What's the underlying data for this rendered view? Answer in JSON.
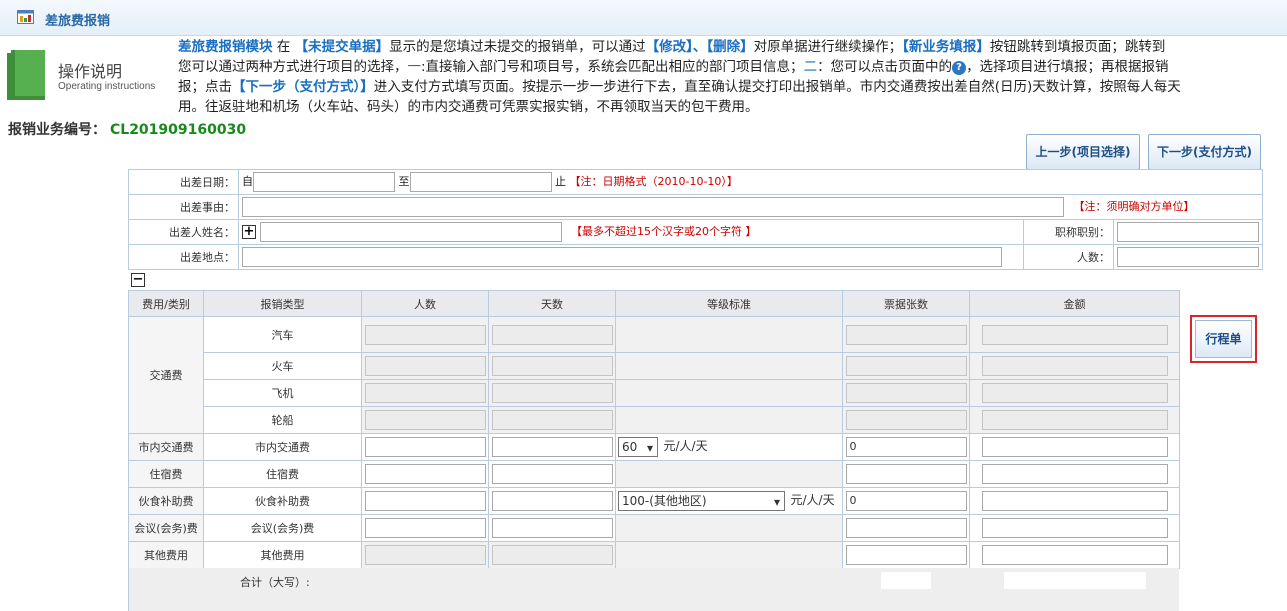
{
  "header": {
    "title": "差旅费报销",
    "icon": "report-icon"
  },
  "instructions": {
    "title": "操作说明",
    "subtitle": "Operating instructions",
    "line1": [
      {
        "t": "差旅费报销模块",
        "blue": true
      },
      {
        "t": " 在 ",
        "blue": false
      },
      {
        "t": "【未提交单据】",
        "blue": true
      },
      {
        "t": "显示的是您填过未提交的报销单，可以通过",
        "blue": false
      },
      {
        "t": "【修改】、【删除】",
        "blue": true
      },
      {
        "t": "对原单据进行继续操作；",
        "blue": false
      },
      {
        "t": "【新业务填报】",
        "blue": true
      },
      {
        "t": "按钮跳转到填报页面；跳转到",
        "blue": false
      }
    ],
    "line2a": "您可以通过两种方式进行项目的选择，",
    "line2b": "一",
    "line2c": ":直接输入部门号和项目号，系统会匹配出相应的部门项目信息；",
    "line2d": "二",
    "line2e": "：您可以点击页面中的",
    "line2f": "，选择项目进行填报；再根据报销",
    "line3a": "报；点击",
    "line3b": "【下一步（支付方式）】",
    "line3c": "进入支付方式填写页面。按提示一步一步进行下去，直至确认提交打印出报销单。市内交通费按出差自然(日历)天数计算，按照每人每天",
    "line4": "用。往返驻地和机场（火车站、码头）的市内交通费可凭票实报实销，不再领取当天的包干费用。"
  },
  "business_no": {
    "label": "报销业务编号：",
    "value": "CL201909160030"
  },
  "buttons": {
    "prev": "上一步(项目选择)",
    "next": "下一步(支付方式)",
    "itinerary": "行程单"
  },
  "form": {
    "date_label": "出差日期：",
    "from": "自",
    "to": "至",
    "end": "止",
    "date_note": "【注：日期格式（2010-10-10）】",
    "reason_label": "出差事由：",
    "reason_note": "【注：须明确对方单位】",
    "name_label": "出差人姓名：",
    "name_note": "【最多不超过15个汉字或20个字符 】",
    "title_label": "职称职别：",
    "place_label": "出差地点：",
    "people_label": "人数："
  },
  "expense": {
    "headers": [
      "费用/类别",
      "报销类型",
      "人数",
      "天数",
      "等级标准",
      "票据张数",
      "金额"
    ],
    "transport_category": "交通费",
    "transport_rows": [
      "汽车",
      "火车",
      "飞机",
      "轮船"
    ],
    "city": {
      "category": "市内交通费",
      "type": "市内交通费",
      "standard": "60",
      "unit": "元/人/天",
      "tickets": "0"
    },
    "lodging": {
      "category": "住宿费",
      "type": "住宿费"
    },
    "meal": {
      "category": "伙食补助费",
      "type": "伙食补助费",
      "standard": "100-(其他地区)",
      "unit": "元/人/天",
      "tickets": "0"
    },
    "meeting": {
      "category": "会议(会务)费",
      "type": "会议(会务)费"
    },
    "other": {
      "category": "其他费用",
      "type": "其他费用"
    },
    "total_label": "合计（大写）:"
  }
}
